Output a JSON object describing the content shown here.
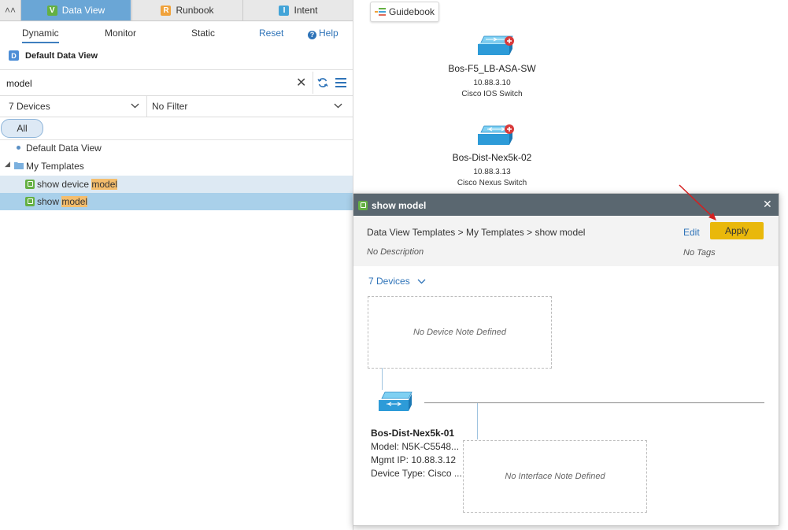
{
  "tabs": [
    {
      "label": "Data View",
      "badge": "V",
      "badge_color": "#64b043"
    },
    {
      "label": "Runbook",
      "badge": "R",
      "badge_color": "#f0a23b"
    },
    {
      "label": "Intent",
      "badge": "I",
      "badge_color": "#43a4d8"
    }
  ],
  "subtabs": {
    "dynamic": "Dynamic",
    "monitor": "Monitor",
    "static": "Static",
    "reset": "Reset",
    "help": "Help"
  },
  "data_view": {
    "icon_letter": "D",
    "title": "Default Data View"
  },
  "search": {
    "value": "model"
  },
  "filters": {
    "devices": "7 Devices",
    "filter": "No Filter"
  },
  "all_pill": "All",
  "tree": {
    "default": "Default Data View",
    "folder": "My Templates",
    "items": [
      {
        "prefix": "show device ",
        "highlight": "model"
      },
      {
        "prefix": "show ",
        "highlight": "model"
      }
    ]
  },
  "guidebook": "Guidebook",
  "map_devices": [
    {
      "name": "Bos-F5_LB-ASA-SW",
      "ip": "10.88.3.10",
      "type": "Cisco IOS Switch"
    },
    {
      "name": "Bos-Dist-Nex5k-02",
      "ip": "10.88.3.13",
      "type": "Cisco Nexus Switch"
    }
  ],
  "dialog": {
    "title": "show model",
    "breadcrumb": "Data View Templates > My Templates > show model",
    "edit": "Edit",
    "apply": "Apply",
    "no_description": "No Description",
    "no_tags": "No Tags",
    "devices_dropdown": "7 Devices",
    "device_note": "No Device Note Defined",
    "interface_note": "No Interface Note Defined",
    "device": {
      "name": "Bos-Dist-Nex5k-01",
      "model": "Model: N5K-C5548...",
      "mgmt_ip": "Mgmt IP: 10.88.3.12",
      "device_type": "Device Type: Cisco ..."
    }
  },
  "colors": {
    "accent": "#6aa6d6",
    "apply": "#e9b80b",
    "highlight": "#f4bd6c",
    "dialog_header": "#5a6770"
  }
}
